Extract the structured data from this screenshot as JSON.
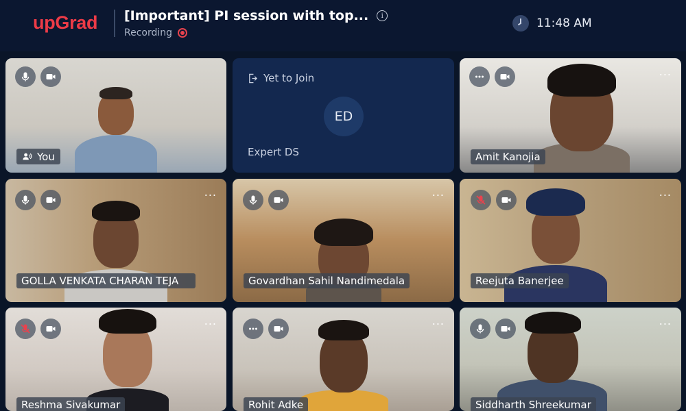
{
  "app": {
    "brand": "upGrad",
    "title": "[Important] PI session with top...",
    "recording_label": "Recording",
    "time": "11:48 AM"
  },
  "icons": {
    "info": "info-icon",
    "recording": "recording-indicator-icon",
    "clock": "clock-icon"
  },
  "colors": {
    "brand": "#ed3b47",
    "background": "#0a1528",
    "recording": "#e8434e",
    "empty_tile": "#13284f"
  },
  "participants": [
    {
      "name": "You",
      "mic": "on",
      "camera": "on",
      "shows_more": false,
      "speaking": true
    },
    {
      "name": "Expert DS",
      "status": "Yet to Join",
      "initials": "ED"
    },
    {
      "name": "Amit Kanojia",
      "mic": "more",
      "camera": "on",
      "shows_more": true
    },
    {
      "name": "GOLLA VENKATA CHARAN TEJA",
      "mic": "on",
      "camera": "on",
      "shows_more": true
    },
    {
      "name": "Govardhan Sahil Nandimedala",
      "mic": "on",
      "camera": "on",
      "shows_more": true
    },
    {
      "name": "Reejuta Banerjee",
      "mic": "muted",
      "camera": "on",
      "shows_more": true
    },
    {
      "name": "Reshma Sivakumar",
      "mic": "muted",
      "camera": "on",
      "shows_more": true
    },
    {
      "name": "Rohit Adke",
      "mic": "more",
      "camera": "on",
      "shows_more": true
    },
    {
      "name": "Siddharth Shreekumar",
      "mic": "on",
      "camera": "on",
      "shows_more": true
    }
  ],
  "labels": {
    "more": "...",
    "yet_to_join": "Yet to Join"
  }
}
